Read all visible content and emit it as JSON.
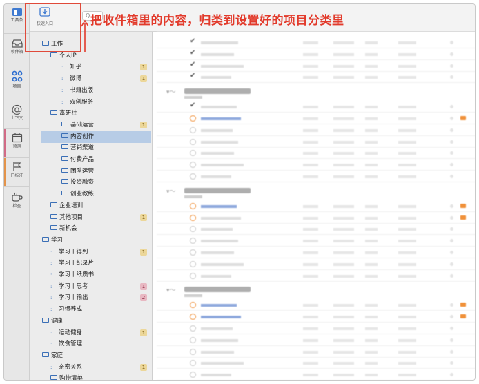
{
  "annotation": {
    "text": "把收件箱里的内容，归类到设置好的项目分类里"
  },
  "toolbar": {
    "tools_label": "工具条",
    "quick_entry_label": "快速入口",
    "search_placeholder": "Q"
  },
  "perspectives": [
    {
      "label": "收件箱",
      "icon": "inbox-tray-icon"
    },
    {
      "label": "项目",
      "icon": "projects-dots-icon"
    },
    {
      "label": "上下文",
      "icon": "at-sign-icon"
    },
    {
      "label": "预测",
      "icon": "calendar-icon"
    },
    {
      "label": "已标注",
      "icon": "flag-icon"
    },
    {
      "label": "检查",
      "icon": "coffee-cup-icon"
    }
  ],
  "projects": [
    {
      "label": "工作",
      "type": "folder",
      "level": 0
    },
    {
      "label": "个人IP",
      "type": "folder",
      "level": 1
    },
    {
      "label": "知乎",
      "type": "project",
      "level": 2,
      "badge": "1"
    },
    {
      "label": "微博",
      "type": "project",
      "level": 2,
      "badge": "1"
    },
    {
      "label": "书籍出版",
      "type": "project",
      "level": 2
    },
    {
      "label": "双创服务",
      "type": "project",
      "level": 2
    },
    {
      "label": "富研社",
      "type": "folder",
      "level": 1
    },
    {
      "label": "基础运营",
      "type": "folder",
      "level": 2,
      "badge": "1"
    },
    {
      "label": "内容创作",
      "type": "folder",
      "level": 2,
      "selected": true
    },
    {
      "label": "营销渠道",
      "type": "folder",
      "level": 2
    },
    {
      "label": "付费产品",
      "type": "folder",
      "level": 2
    },
    {
      "label": "团队运营",
      "type": "folder",
      "level": 2
    },
    {
      "label": "投资融资",
      "type": "folder",
      "level": 2
    },
    {
      "label": "创业教练",
      "type": "folder",
      "level": 2
    },
    {
      "label": "企业培训",
      "type": "folder",
      "level": 1
    },
    {
      "label": "其他项目",
      "type": "folder",
      "level": 1,
      "badge": "1"
    },
    {
      "label": "新机会",
      "type": "folder",
      "level": 1
    },
    {
      "label": "学习",
      "type": "folder",
      "level": 0
    },
    {
      "label": "学习丨得到",
      "type": "project",
      "level": 1,
      "badge": "1"
    },
    {
      "label": "学习丨纪录片",
      "type": "project",
      "level": 1
    },
    {
      "label": "学习丨纸质书",
      "type": "project",
      "level": 1
    },
    {
      "label": "学习丨思考",
      "type": "project",
      "level": 1,
      "badge": "1",
      "badge_color": "red"
    },
    {
      "label": "学习丨输出",
      "type": "project",
      "level": 1,
      "badge": "2",
      "badge_color": "red"
    },
    {
      "label": "习惯养成",
      "type": "project",
      "level": 1
    },
    {
      "label": "健康",
      "type": "folder",
      "level": 0
    },
    {
      "label": "运动健身",
      "type": "project",
      "level": 1,
      "badge": "1"
    },
    {
      "label": "饮食管理",
      "type": "project",
      "level": 1
    },
    {
      "label": "家庭",
      "type": "folder",
      "level": 0
    },
    {
      "label": "亲密关系",
      "type": "project",
      "level": 1,
      "badge": "1"
    },
    {
      "label": "购物清单",
      "type": "folder",
      "level": 1
    }
  ],
  "colors": {
    "accent_blue": "#3b6fb6",
    "selection": "#b7cce6",
    "annotation_red": "#e23a2b",
    "flag_orange": "#f0913a",
    "badge_yellow": "#ecd79a",
    "badge_red": "#e8b8c2"
  }
}
